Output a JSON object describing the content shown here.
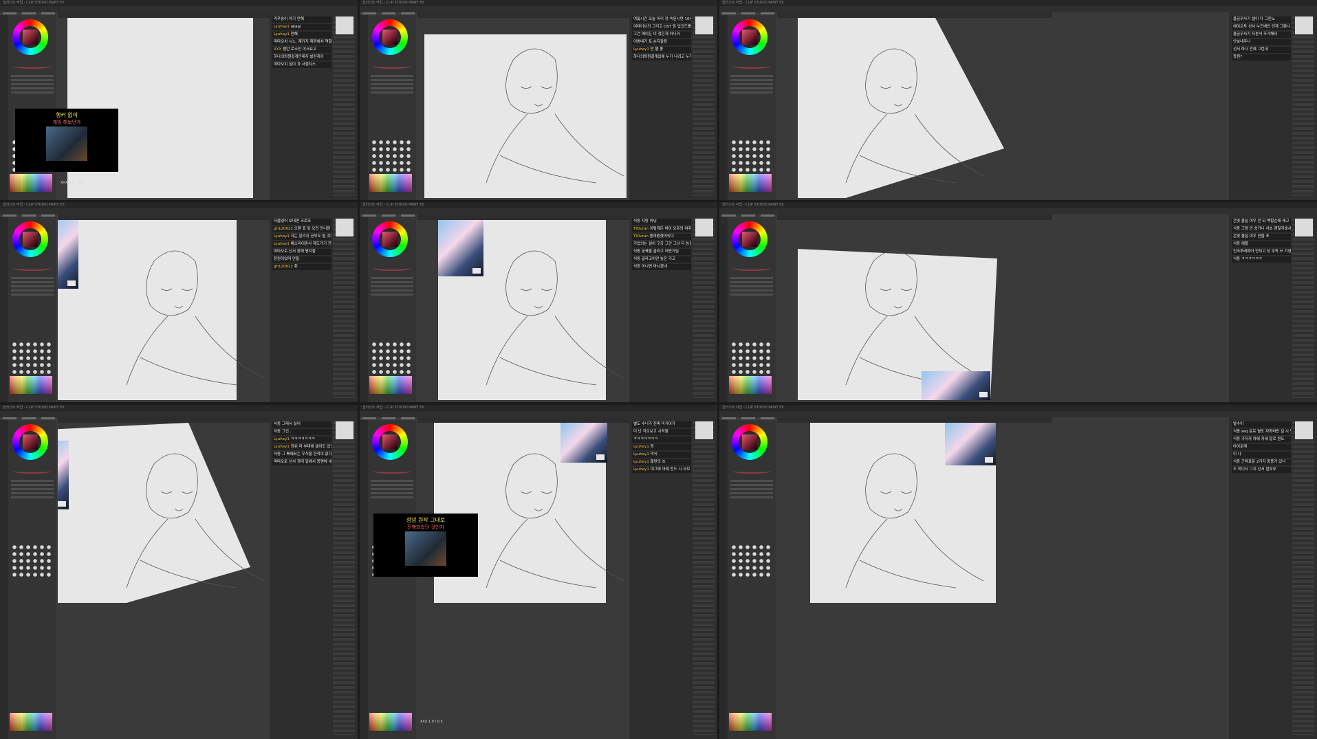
{
  "window_title": "일러스트 작업 - CLIP STUDIO PAINT EX",
  "menu": [
    "파일",
    "편집",
    "페이지 관리",
    "애니메이션",
    "레이어",
    "선택 범위",
    "보기",
    "필터",
    "창",
    "도움말"
  ],
  "panels": [
    {
      "chat": [
        {
          "user": "",
          "text": "라푸송이 야기 만해"
        },
        {
          "user": "Lyuhey1",
          "text": "akagi"
        },
        {
          "user": "Lyuhey1",
          "text": "만해"
        },
        {
          "user": "",
          "text": "따따오치 시노. 제키지 재판에서 역할을 맡너이면 개주~~"
        },
        {
          "user": "XXX",
          "text": "팬던 로소인 이서요고"
        },
        {
          "user": "",
          "text": "하나의퇴원걸개인데저 발걷게이"
        },
        {
          "user": "",
          "text": "따따오치 설이 과 서점지스"
        }
      ],
      "overlay": {
        "title": "행커 없이",
        "subtitle": "게임 해보던가"
      },
      "status": "XXX 1.0 / 0.5"
    },
    {
      "chat": [
        {
          "user": "",
          "text": "여덟시간 오늘 어리 정 속된시면 10시만 시범라 보이 좋네"
        },
        {
          "user": "",
          "text": "여태이브의 그리고 OST 링 업코드를"
        },
        {
          "user": "",
          "text": "그건 예이든 이 정은게 아니라"
        },
        {
          "user": "",
          "text": "이범네기 토 순지잘음"
        },
        {
          "user": "Lyuhey1",
          "text": "반 볼 좋"
        },
        {
          "user": "",
          "text": "하나의퇴원걸개있에 누가 나려고 누가 노래말하!"
        }
      ]
    },
    {
      "chat": [
        {
          "user": "",
          "text": "을금무사기 셀이 다 그린노"
        },
        {
          "user": "",
          "text": "예이오투 선서 누드베인 언제 그랜니"
        },
        {
          "user": "",
          "text": "을금무사기 자본셔 추가해서"
        },
        {
          "user": "",
          "text": "안보내주니"
        },
        {
          "user": "",
          "text": "선서 하나 언제 그런네"
        },
        {
          "user": "",
          "text": "등원?"
        }
      ]
    },
    {
      "chat": [
        {
          "user": "",
          "text": "터물었어 보내면 크로조"
        },
        {
          "user": "gh120622",
          "text": "오랜 표 앞 오전 언니음"
        },
        {
          "user": "Lyuhey1",
          "text": "저는 알리쉬 공부도 될 것이다"
        },
        {
          "user": "Lyuhey1",
          "text": "해소리어판서 게도가기 전 3화 보스까지 간디. 시전들"
        },
        {
          "user": "",
          "text": "따따오토 선서 판매 왕지찰"
        },
        {
          "user": "",
          "text": "등원이었머 만들"
        },
        {
          "user": "gh120622",
          "text": "취"
        }
      ]
    },
    {
      "chat": [
        {
          "user": "",
          "text": "식동 지방 여닝"
        },
        {
          "user": "TIDuran",
          "text": "이렇게든 바이 오주의 여주주가 왼쪽에 역할 만을 여서 만네를 자 128만지의 온다요 만들어버러야겠다"
        },
        {
          "user": "TIDuran",
          "text": "좀까봤겠어잇다"
        },
        {
          "user": "",
          "text": "가업의는 설이 구공 그건 그냥 다 농은 옷"
        },
        {
          "user": "",
          "text": "식동 굳육을 골라고 어떤거임"
        },
        {
          "user": "",
          "text": "식동 골라고이면 높은 거고"
        },
        {
          "user": "",
          "text": "식동 아니면 마시겠네"
        }
      ]
    },
    {
      "chat": [
        {
          "user": "",
          "text": "은빛 올실 여우 만 되 백합순애 래고"
        },
        {
          "user": "",
          "text": "식동 그럼 안 송가니 사초 괜찮지쇄서"
        },
        {
          "user": "",
          "text": "은빛 올실 여우 만을 포"
        },
        {
          "user": "",
          "text": "식동 애플"
        },
        {
          "user": "",
          "text": "인숙투배류어 안되고 성 우독 쓰 기장 겨가엔다"
        },
        {
          "user": "",
          "text": "식동 ㅋㅋㅋㅋㅋㅋ"
        }
      ]
    },
    {
      "chat": [
        {
          "user": "",
          "text": "식동 그래서 실어"
        },
        {
          "user": "",
          "text": "식동 그건.."
        },
        {
          "user": "Lyuhey1",
          "text": "ㅋㅋㅋㅋㅋㅋㅋ"
        },
        {
          "user": "Lyuhey1",
          "text": "좌쉬 라 부대에 셀이도 있겠지?"
        },
        {
          "user": "",
          "text": "식동 그 빠에쓰는 우식을 한적이 없다고"
        },
        {
          "user": "",
          "text": "따따오토 선서 정대 밑에서 용맨에 네일가서 한 후 사이로 순 남 어서 제인 풀런서 이지되도 드코레 우 아토니우도 이라는 공유코고"
        }
      ]
    },
    {
      "chat": [
        {
          "user": "",
          "text": "별도 수니가 진짜 미거이가"
        },
        {
          "user": "",
          "text": "더 난 각오보고 시작함"
        },
        {
          "user": "",
          "text": "ㅋㅋㅋㅋㅋㅋㅋ"
        },
        {
          "user": "Lyuhey1",
          "text": "등"
        },
        {
          "user": "Lyuhey1",
          "text": "악식"
        },
        {
          "user": "Lyuhey1",
          "text": "불란의 초"
        },
        {
          "user": "Lyuhey1",
          "text": "대그에 아예 전드 시 사보 기로은 그밖 그. 그냥이 오"
        }
      ],
      "overlay": {
        "title": "정녕 원작 그대로",
        "subtitle": "진행되었던 것인가"
      },
      "status": "XXX 1.0 / 0.5"
    },
    {
      "chat": [
        {
          "user": "",
          "text": "발수이"
        },
        {
          "user": "",
          "text": "식동 seq 운료 별도 자하비만 걸 시 민중에 삼실 있던 이 그들우 너 하 아니나"
        },
        {
          "user": "",
          "text": "식동 가지자 차에 자세 알로 원도"
        },
        {
          "user": "",
          "text": "아이토레"
        },
        {
          "user": "",
          "text": "이 나"
        },
        {
          "user": "",
          "text": "식동 근육표운 2가지 중용가 있나"
        },
        {
          "user": "",
          "text": "즈 미디닉 그치 선서 발부부"
        }
      ]
    }
  ],
  "colors": {
    "accent": "#f3c13a",
    "canvas": "#e7e7e7",
    "ui_bg": "#3b3b3b"
  },
  "icons": [
    "color-wheel-icon",
    "brush-icon",
    "layer-icon",
    "eye-icon"
  ]
}
